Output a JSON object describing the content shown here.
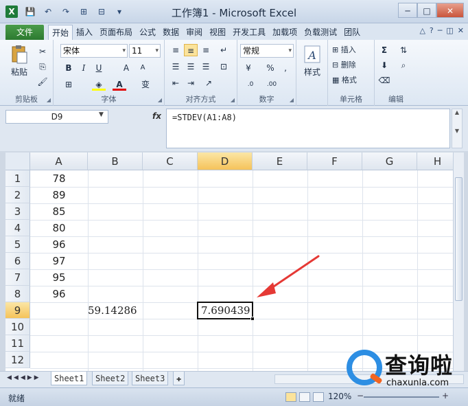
{
  "window": {
    "title": "工作簿1 - Microsoft Excel",
    "app_letter": "X"
  },
  "qat": {
    "save": "💾",
    "undo": "↶",
    "redo": "↷",
    "custom1": "⊞",
    "custom2": "⊟",
    "customize": "▾"
  },
  "tabs": {
    "file": "文件",
    "items": [
      "开始",
      "插入",
      "页面布局",
      "公式",
      "数据",
      "审阅",
      "视图",
      "开发工具",
      "加载项",
      "负载测试",
      "团队"
    ],
    "active_index": 0
  },
  "ribbon": {
    "clipboard": {
      "label": "剪贴板",
      "paste": "粘贴"
    },
    "font": {
      "label": "字体",
      "name": "宋体",
      "size": "11",
      "bold": "B",
      "italic": "I",
      "underline": "U",
      "grow": "A",
      "shrink": "A",
      "phonetic": "变"
    },
    "alignment": {
      "label": "对齐方式"
    },
    "number": {
      "label": "数字",
      "format": "常规",
      "percent": "%",
      "comma": ",",
      "inc": ".0",
      "dec": ".00"
    },
    "styles": {
      "label": "样式",
      "button": "样式"
    },
    "cells": {
      "label": "单元格",
      "insert": "插入",
      "delete": "删除",
      "format": "格式"
    },
    "editing": {
      "label": "编辑",
      "sum": "Σ"
    }
  },
  "formula_bar": {
    "name_box": "D9",
    "fx": "fx",
    "formula": "=STDEV(A1:A8)"
  },
  "columns": [
    "A",
    "B",
    "C",
    "D",
    "E",
    "F",
    "G",
    "H"
  ],
  "active_column": "D",
  "rows": [
    "1",
    "2",
    "3",
    "4",
    "5",
    "6",
    "7",
    "8",
    "9",
    "10",
    "11",
    "12"
  ],
  "active_row": "9",
  "cells": {
    "A": [
      "78",
      "89",
      "85",
      "80",
      "96",
      "97",
      "95",
      "96"
    ],
    "B9": "59.14286",
    "D9": "7.690439"
  },
  "sheets": [
    "Sheet1",
    "Sheet2",
    "Sheet3"
  ],
  "active_sheet": 0,
  "status": {
    "text": "就绪",
    "zoom": "120%"
  },
  "watermark": {
    "text": "查询啦",
    "url": "chaxunla.com"
  },
  "colors": {
    "accent": "#2c7a30",
    "selection_header": "#f5c35a",
    "arrow": "#e53935"
  }
}
